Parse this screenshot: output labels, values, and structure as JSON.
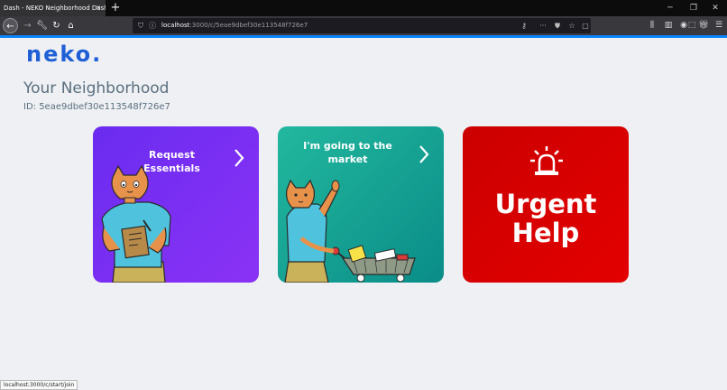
{
  "browser": {
    "tab_title": "Dash - NEKO Neighborhood Dashb",
    "tab_close": "×",
    "new_tab": "+",
    "url_host": "localhost",
    "url_path": ":3000/c/5eae9dbef30e113548f726e7",
    "status_url": "localhost:3000/c/start/join"
  },
  "app": {
    "logo": "neko.",
    "title": "Your Neighborhood",
    "neighborhood_id": "ID: 5eae9dbef30e113548f726e7"
  },
  "cards": {
    "request": {
      "label": "Request Essentials",
      "color": "#7b2ff7"
    },
    "market": {
      "label": "I'm going to the market",
      "color": "#14a394"
    },
    "urgent": {
      "line1": "Urgent",
      "line2": "Help",
      "color": "#d90000"
    }
  },
  "colors": {
    "accent": "#0a84ff",
    "logo": "#1f5fd6",
    "text_muted": "#5b6f7f",
    "page_bg": "#eef0f3"
  }
}
